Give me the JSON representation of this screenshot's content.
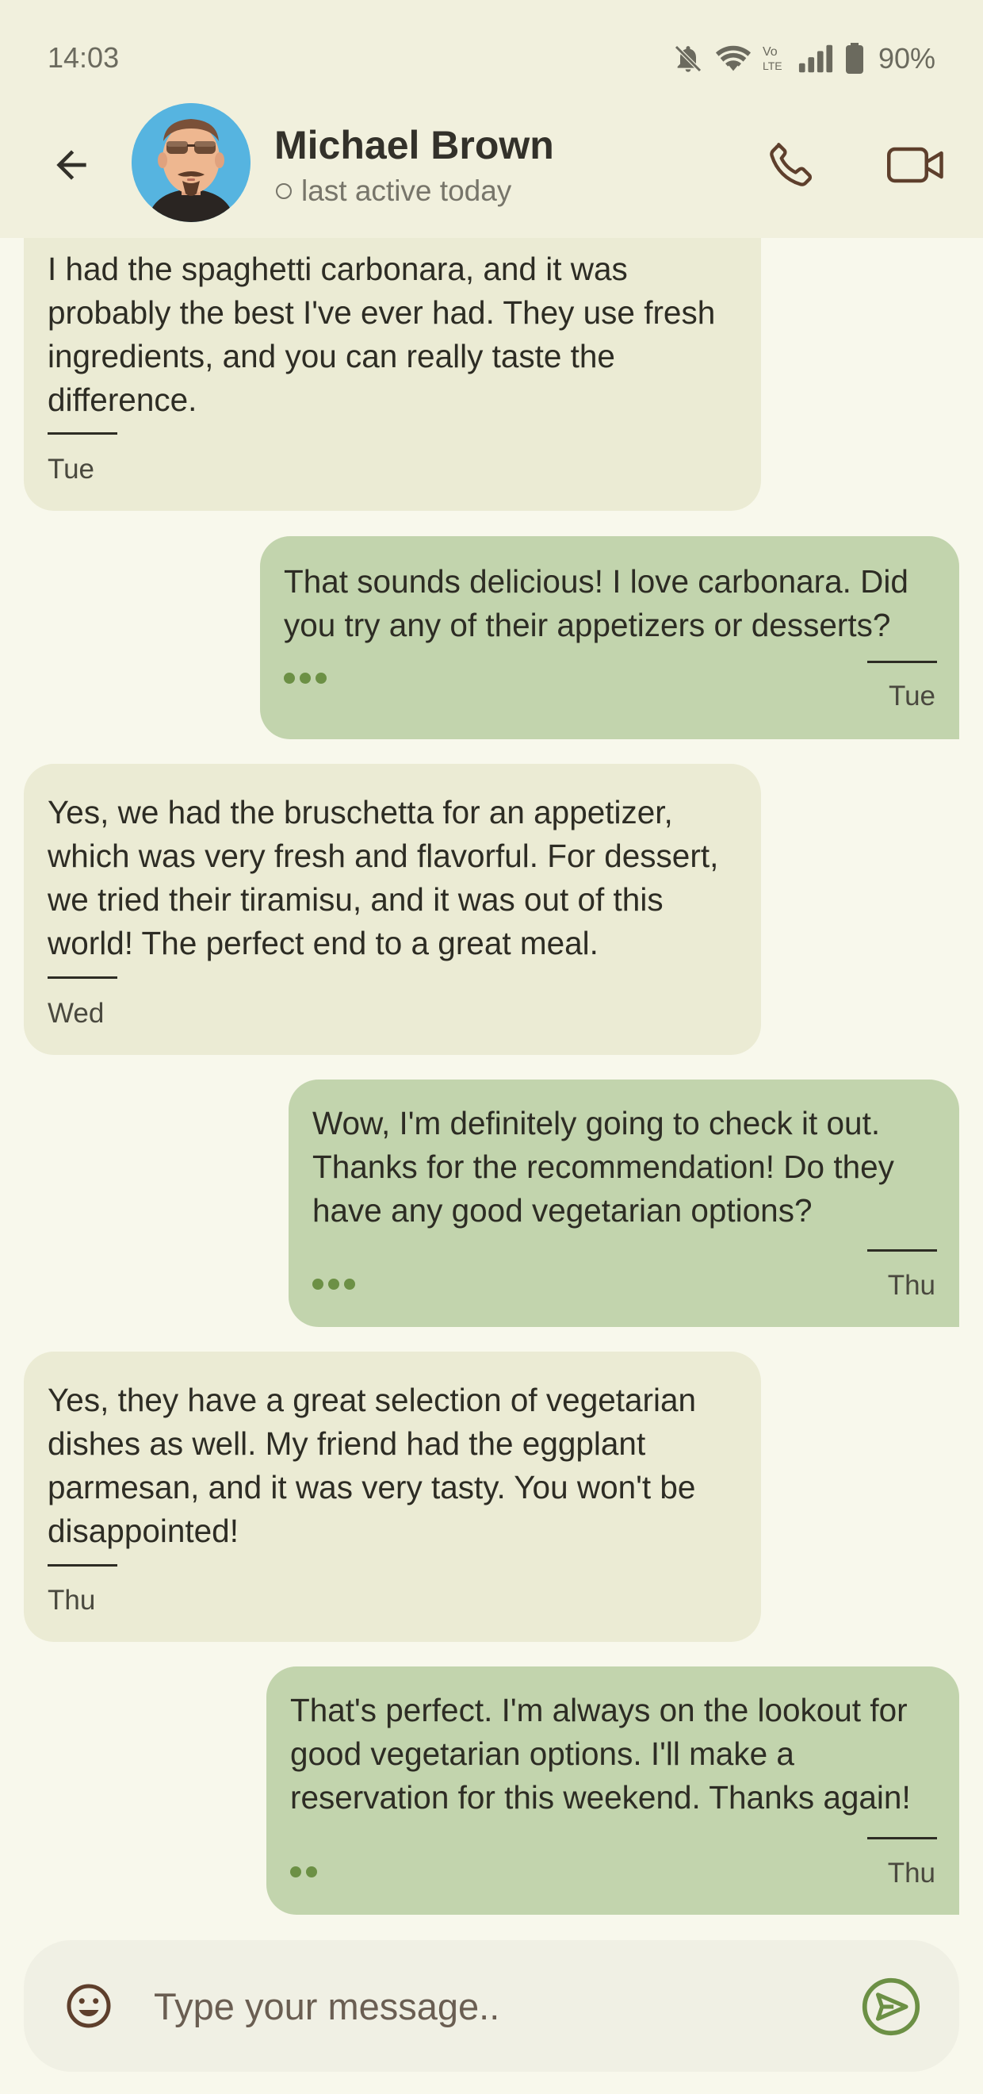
{
  "status_bar": {
    "time": "14:03",
    "battery": "90%",
    "icons": [
      "bell-off-icon",
      "wifi-icon",
      "volte-icon",
      "signal-icon",
      "battery-icon"
    ]
  },
  "header": {
    "name": "Michael Brown",
    "presence": "last active today",
    "icons": [
      "back-arrow-icon",
      "phone-icon",
      "video-icon"
    ]
  },
  "messages": [
    {
      "direction": "in",
      "text": "I had the spaghetti carbonara, and it was probably the best I've ever had. They use fresh ingredients, and you can really taste the difference.",
      "time": "Tue"
    },
    {
      "direction": "out",
      "text": "That sounds delicious! I love carbonara. Did you try any of their appetizers or desserts?",
      "time": "Tue",
      "status": "three-dots"
    },
    {
      "direction": "in",
      "text": "Yes, we had the bruschetta for an appetizer, which was very fresh and flavorful. For dessert, we tried their tiramisu, and it was out of this world! The perfect end to a great meal.",
      "time": "Wed"
    },
    {
      "direction": "out",
      "text": "Wow, I'm definitely going to check it out. Thanks for the recommendation! Do they have any good vegetarian options?",
      "time": "Thu",
      "status": "three-dots"
    },
    {
      "direction": "in",
      "text": "Yes, they have a great selection of vegetarian dishes as well. My friend had the eggplant parmesan, and it was very tasty. You won't be disappointed!",
      "time": "Thu"
    },
    {
      "direction": "out",
      "text": "That's perfect. I'm always on the lookout for good vegetarian options. I'll make a reservation for this weekend. Thanks again!",
      "time": "Thu",
      "status": "two-dots"
    }
  ],
  "composer": {
    "placeholder": "Type your message..",
    "icons": [
      "emoji-icon",
      "send-icon"
    ]
  },
  "colors": {
    "header_bg": "#f1f0dd",
    "page_bg": "#f8f8ec",
    "incoming_bubble": "#ebebd4",
    "outgoing_bubble": "#c2d4ad",
    "accent_green": "#6c9045"
  }
}
